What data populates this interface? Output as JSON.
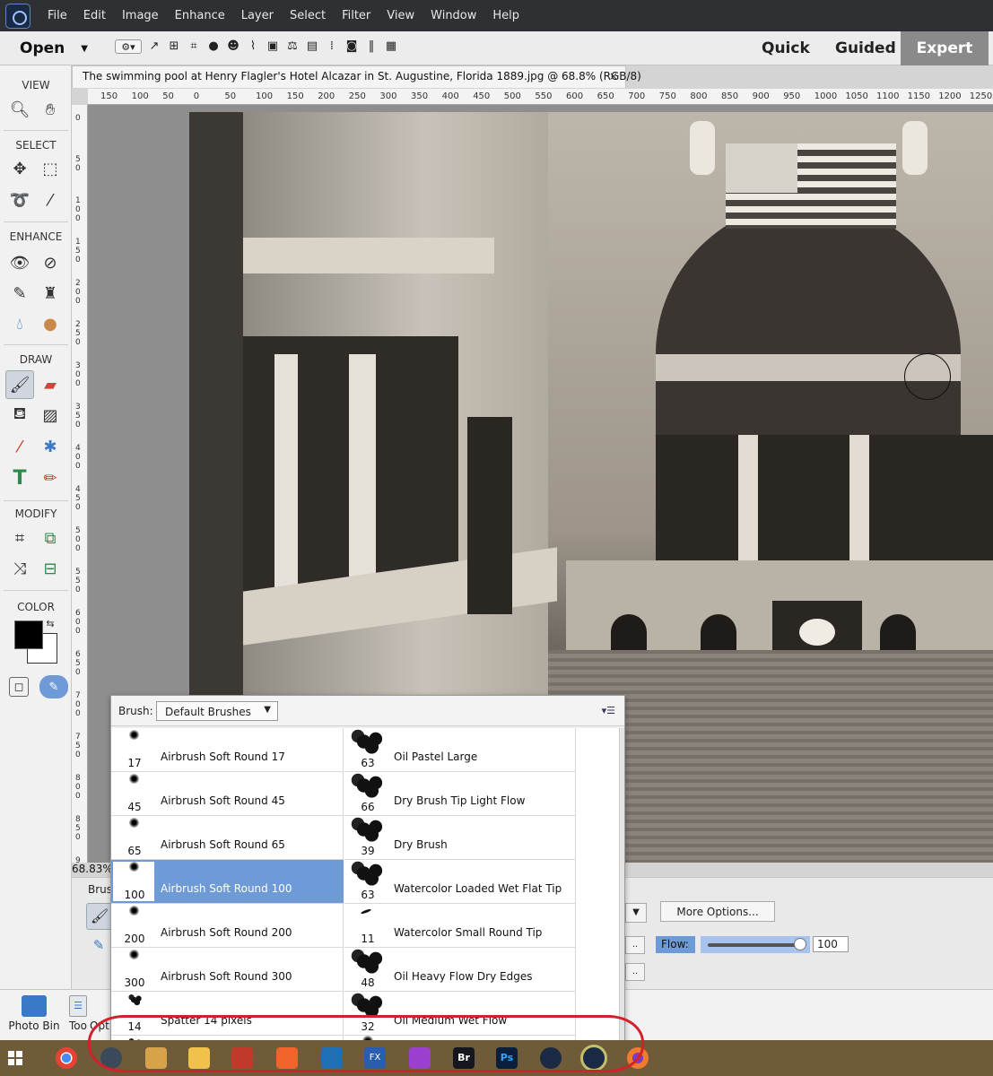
{
  "menubar": {
    "items": [
      "File",
      "Edit",
      "Image",
      "Enhance",
      "Layer",
      "Select",
      "Filter",
      "View",
      "Window",
      "Help"
    ]
  },
  "optionsbar": {
    "open_label": "Open",
    "modes": [
      "Quick",
      "Guided",
      "Expert"
    ],
    "active_mode": "Expert"
  },
  "tools": {
    "sections": [
      "VIEW",
      "SELECT",
      "ENHANCE",
      "DRAW",
      "MODIFY",
      "COLOR"
    ]
  },
  "document": {
    "tab_title": "The swimming pool at Henry Flagler's Hotel Alcazar in St. Augustine, Florida 1889.jpg @ 68.8% (RGB/8)",
    "close_glyph": "×",
    "zoom": "68.83%"
  },
  "ruler": {
    "horizontal": [
      "150",
      "100",
      "50",
      "0",
      "50",
      "100",
      "150",
      "200",
      "250",
      "300",
      "350",
      "400",
      "450",
      "500",
      "550",
      "600",
      "650",
      "700",
      "750",
      "800",
      "850",
      "900",
      "950",
      "1000",
      "1050",
      "1100",
      "1150",
      "1200",
      "1250"
    ],
    "vertical": [
      "0",
      "50",
      "100",
      "150",
      "200",
      "250",
      "300",
      "350",
      "400",
      "450",
      "500",
      "550",
      "600",
      "650",
      "700",
      "750",
      "800",
      "850",
      "900"
    ]
  },
  "picker": {
    "brush_label": "Brush:",
    "brush_set": "Default Brushes",
    "brushes_left": [
      {
        "size": "17",
        "name": "Airbrush Soft Round 17"
      },
      {
        "size": "45",
        "name": "Airbrush Soft Round 45"
      },
      {
        "size": "65",
        "name": "Airbrush Soft Round 65"
      },
      {
        "size": "100",
        "name": "Airbrush Soft Round 100",
        "selected": true
      },
      {
        "size": "200",
        "name": "Airbrush Soft Round 200"
      },
      {
        "size": "300",
        "name": "Airbrush Soft Round 300"
      },
      {
        "size": "14",
        "name": "Spatter 14 pixels"
      },
      {
        "size": "24",
        "name": "Spatter 24 pixels"
      }
    ],
    "brushes_right": [
      {
        "size": "63",
        "name": "Oil Pastel Large"
      },
      {
        "size": "66",
        "name": "Dry Brush Tip Light Flow"
      },
      {
        "size": "39",
        "name": "Dry Brush"
      },
      {
        "size": "63",
        "name": "Watercolor Loaded Wet Flat Tip"
      },
      {
        "size": "11",
        "name": "Watercolor Small Round Tip"
      },
      {
        "size": "48",
        "name": "Oil Heavy Flow Dry Edges"
      },
      {
        "size": "32",
        "name": "Oil Medium Wet Flow"
      },
      {
        "size": "75",
        "name": "Wet Sponge"
      }
    ]
  },
  "options_panel": {
    "brush_label": "Brus",
    "more_options_label": "More Options...",
    "flow_label": "Flow:",
    "flow_value": "100"
  },
  "binbar": {
    "photo_bin_label": "Photo Bin",
    "tool_options_label": "Too",
    "options_label": "Opt"
  },
  "colors": {
    "menubar_bg": "#2f3034",
    "selection_blue": "#6e9ad8",
    "annotation_red": "#d4202a",
    "expert_mode_bg": "#8a8a8a"
  },
  "taskbar": {
    "apps": [
      "windows-start",
      "chrome",
      "steam",
      "pencil",
      "file-explorer",
      "screen-capture",
      "brave",
      "affinity",
      "fx",
      "arrow-app",
      "bridge",
      "photoshop",
      "elements-organizer",
      "elements-editor",
      "firefox"
    ]
  }
}
